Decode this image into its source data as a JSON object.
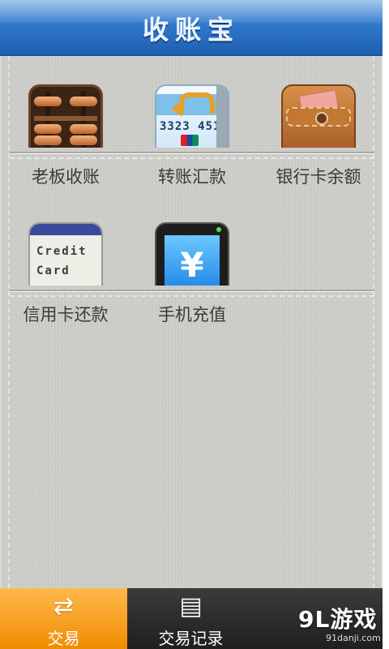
{
  "header": {
    "title": "收账宝"
  },
  "tiles": [
    {
      "label": "老板收账",
      "icon": "abacus-icon"
    },
    {
      "label": "转账汇款",
      "icon": "bank-card-transfer-icon",
      "card_number": "3323 451"
    },
    {
      "label": "银行卡余额",
      "icon": "wallet-icon"
    },
    {
      "label": "信用卡还款",
      "icon": "credit-card-icon",
      "card_text": "Credit Card"
    },
    {
      "label": "手机充值",
      "icon": "mobile-phone-yen-icon",
      "screen_symbol": "¥"
    }
  ],
  "tabbar": {
    "tabs": [
      {
        "label": "交易",
        "icon": "transaction-arrows-icon",
        "glyph": "⇄",
        "active": true
      },
      {
        "label": "交易记录",
        "icon": "document-icon",
        "glyph": "▤",
        "active": false
      }
    ]
  },
  "watermark": {
    "logo": "9L游戏",
    "url": "91danji.com"
  },
  "colors": {
    "header_blue": "#2f78cc",
    "active_tab_orange": "#f08c00",
    "panel_gray": "#cfcfcb",
    "tabbar_dark": "#2a2a2a"
  }
}
